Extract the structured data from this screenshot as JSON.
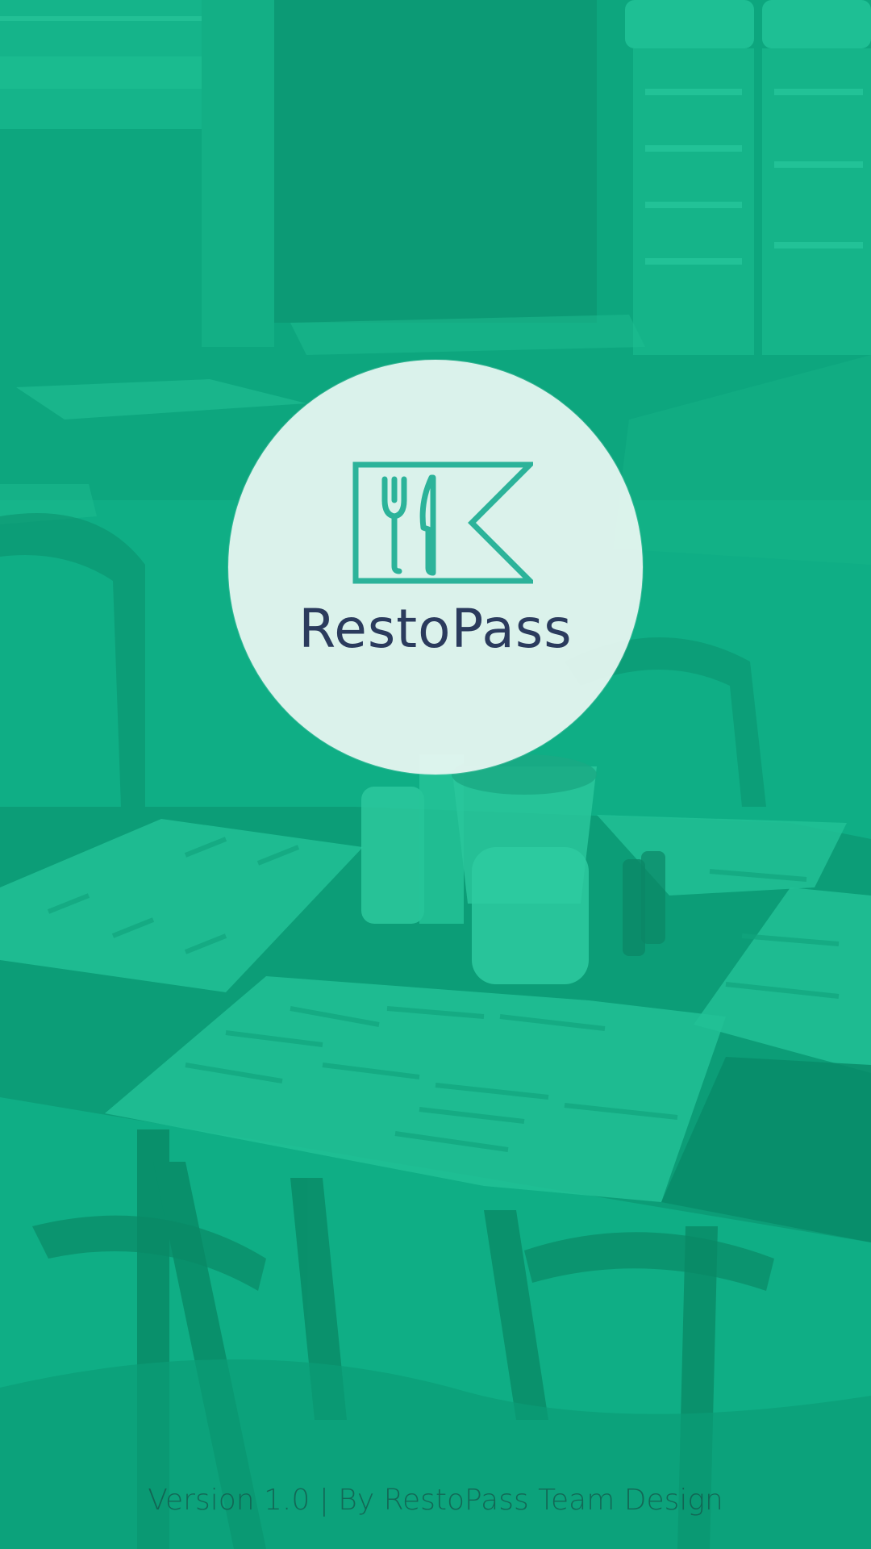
{
  "splash": {
    "brand_name": "RestoPass",
    "logo_icon": "fork-knife-flag-icon",
    "version_text": "Version 1.0 | By RestoPass Team Design"
  },
  "colors": {
    "overlay_green": "#0fae84",
    "logo_teal": "#2cb39a",
    "brand_navy": "#2b3b5d",
    "circle_fill": "#ebf8f3"
  }
}
